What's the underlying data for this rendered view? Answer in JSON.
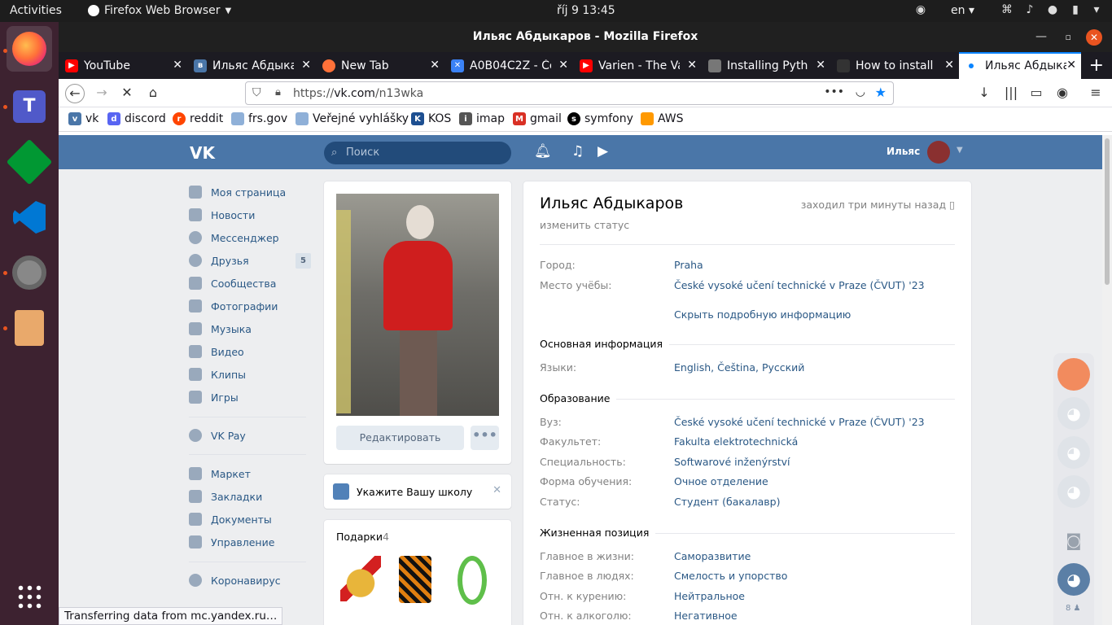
{
  "topbar": {
    "activities": "Activities",
    "app_name": "Firefox Web Browser",
    "clock": "říj 9  13:45",
    "lang": "en"
  },
  "window": {
    "title": "Ильяс Абдыкаров - Mozilla Firefox"
  },
  "tabs": [
    {
      "label": "YouTube",
      "icon": "youtube-icon",
      "color": "#ff0000"
    },
    {
      "label": "Ильяс Абдыка",
      "icon": "vk-icon",
      "color": "#4a76a8"
    },
    {
      "label": "New Tab",
      "icon": "firefox-icon",
      "color": "#ff7139"
    },
    {
      "label": "A0B04C2Z - Če",
      "icon": "page-icon",
      "color": "#3b82f6"
    },
    {
      "label": "Varien - The Va",
      "icon": "youtube-icon",
      "color": "#ff0000"
    },
    {
      "label": "Installing Pyth",
      "icon": "doc-icon",
      "color": "#555555"
    },
    {
      "label": "How to install",
      "icon": "page-icon",
      "color": "#333333"
    },
    {
      "label": "Ильяс Абдыка",
      "icon": "vk-icon",
      "color": "#4a76a8"
    }
  ],
  "navbar": {
    "url_prefix": "https://",
    "url_domain": "vk.com",
    "url_path": "/n13wka"
  },
  "bookmarks": [
    {
      "label": "vk",
      "color": "#4a76a8",
      "glyph": "vk"
    },
    {
      "label": "discord",
      "color": "#5865f2",
      "glyph": "d"
    },
    {
      "label": "reddit",
      "color": "#ff4500",
      "glyph": "r"
    },
    {
      "label": "frs.gov",
      "color": "#8fb0d8",
      "glyph": "f"
    },
    {
      "label": "Veřejné vyhlášky",
      "color": "#8fb0d8",
      "glyph": "v"
    },
    {
      "label": "KOS",
      "color": "#1d4f91",
      "glyph": "K"
    },
    {
      "label": "imap",
      "color": "#333333",
      "glyph": "i"
    },
    {
      "label": "gmail",
      "color": "#d93025",
      "glyph": "M"
    },
    {
      "label": "symfony",
      "color": "#000000",
      "glyph": "s"
    },
    {
      "label": "AWS",
      "color": "#ff9900",
      "glyph": "A"
    }
  ],
  "vk": {
    "search_placeholder": "Поиск",
    "user_short": "Ильяс",
    "nav": [
      {
        "label": "Моя страница"
      },
      {
        "label": "Новости"
      },
      {
        "label": "Мессенджер"
      },
      {
        "label": "Друзья",
        "badge": "5"
      },
      {
        "label": "Сообщества"
      },
      {
        "label": "Фотографии"
      },
      {
        "label": "Музыка"
      },
      {
        "label": "Видео"
      },
      {
        "label": "Клипы"
      },
      {
        "label": "Игры"
      },
      {
        "label": "VK Pay"
      },
      {
        "label": "Маркет"
      },
      {
        "label": "Закладки"
      },
      {
        "label": "Документы"
      },
      {
        "label": "Управление"
      },
      {
        "label": "Коронавирус"
      }
    ],
    "edit_button": "Редактировать",
    "more_button": "•••",
    "school_prompt": "Укажите Вашу школу",
    "gifts_title": "Подарки",
    "gifts_count": "4",
    "profile": {
      "name": "Ильяс Абдыкаров",
      "status": "изменить статус",
      "online": "заходил три минуты назад",
      "city_label": "Город:",
      "city": "Praha",
      "study_label": "Место учёбы:",
      "study": "České vysoké učení technické v Praze (ČVUT) '23",
      "hide_details": "Скрыть подробную информацию",
      "main_info_title": "Основная информация",
      "languages_label": "Языки:",
      "lang_1": "English",
      "lang_2": "Čeština",
      "lang_3": "Русский",
      "education_title": "Образование",
      "uni_label": "Вуз:",
      "uni": "České vysoké učení technické v Praze (ČVUT) '23",
      "faculty_label": "Факультет:",
      "faculty": "Fakulta elektrotechnická",
      "specialty_label": "Специальность:",
      "specialty": "Softwarové inženýrství",
      "form_label": "Форма обучения:",
      "form": "Очное отделение",
      "status_label": "Статус:",
      "status_val": "Студент (бакалавр)",
      "life_title": "Жизненная позиция",
      "life_main_label": "Главное в жизни:",
      "life_main": "Саморазвитие",
      "people_main_label": "Главное в людях:",
      "people_main": "Смелость и упорство",
      "smoking_label": "Отн. к курению:",
      "smoking": "Нейтральное",
      "alcohol_label": "Отн. к алкоголю:",
      "alcohol": "Негативное"
    },
    "online_friends_count": "8"
  },
  "status_bar": "Transferring data from mc.yandex.ru…"
}
